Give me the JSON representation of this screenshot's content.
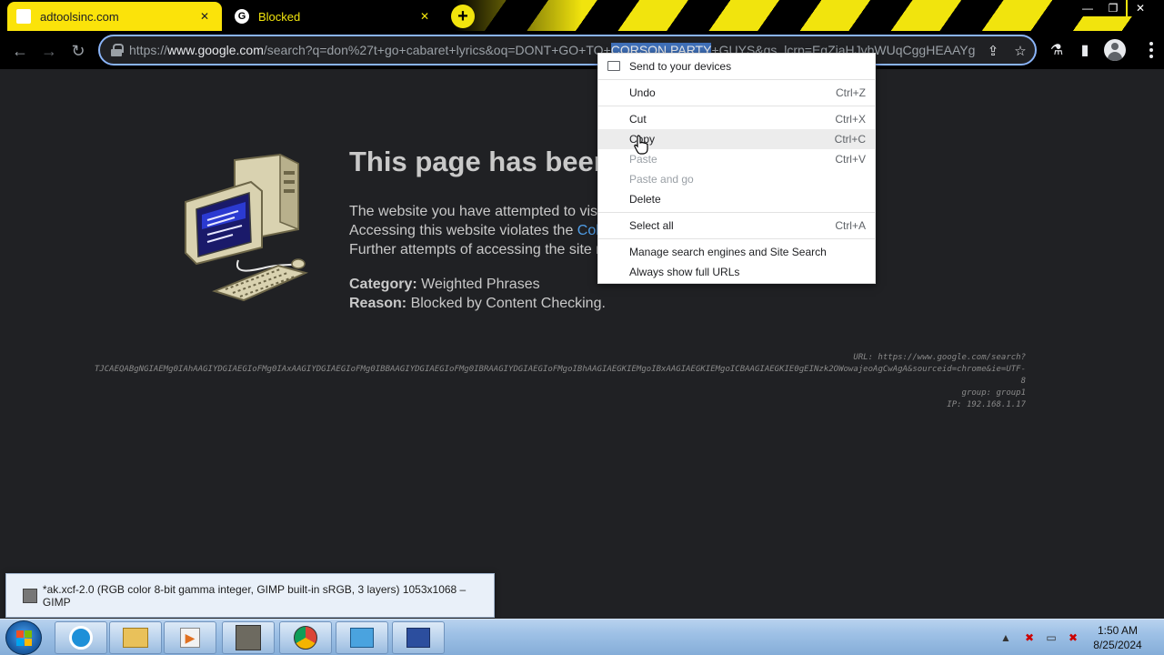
{
  "browser": {
    "tabs": [
      {
        "title": "adtoolsinc.com",
        "active": false
      },
      {
        "title": "Blocked",
        "active": true
      }
    ],
    "new_tab_icon": "plus-icon",
    "window_controls": [
      "minimize-icon",
      "restore-icon",
      "close-icon"
    ],
    "nav": [
      "back-arrow-icon",
      "forward-arrow-icon",
      "reload-icon"
    ],
    "url": {
      "scheme": "https://",
      "host": "www.google.com",
      "path_before_selection": "/search?q=don%27t+go+cabaret+lyrics&oq=DONT+GO+TO+",
      "selected": "CORSON PARTY",
      "path_after_selection": "+GUYS&gs_lcrp=EgZjaHJvbWUqCggHEAAYgAC"
    },
    "toolbar_icons": [
      "share-icon",
      "star-icon",
      "extension-icon",
      "sidepanel-icon",
      "profile-avatar-icon",
      "menu-icon"
    ]
  },
  "page": {
    "heading": "This page has been",
    "paragraph": {
      "line1": "The website you have attempted to vis",
      "line2_prefix": "Accessing this website violates the ",
      "line2_link": "Coll",
      "line3": "Further attempts of accessing the site n"
    },
    "category_label": "Category:",
    "category_value": "Weighted Phrases",
    "reason_label": "Reason:",
    "reason_value": "Blocked by Content Checking.",
    "debug": {
      "url_line": "URL: https://www.google.com/search?",
      "url_query": "TJCAEQABgNGIAEMg0IAhAAGIYDGIAEGIoFMg0IAxAAGIYDGIAEGIoFMg0IBBAAGIYDGIAEGIoFMg0IBRAAGIYDGIAEGIoFMgoIBhAAGIAEGKIEMgoIBxAAGIAEGKIEMgoICBAAGIAEGKIE0gEINzk2OWowajeoAgCwAgA&sourceid=chrome&ie=UTF-",
      "url_tail": "8",
      "group": "group: group1",
      "ip": "IP: 192.168.1.17"
    }
  },
  "context_menu": {
    "send_to_devices": "Send to your devices",
    "items": [
      {
        "label": "Undo",
        "shortcut": "Ctrl+Z"
      },
      {
        "label": "Cut",
        "shortcut": "Ctrl+X"
      },
      {
        "label": "Copy",
        "shortcut": "Ctrl+C"
      },
      {
        "label": "Paste",
        "shortcut": "Ctrl+V"
      },
      {
        "label": "Paste and go",
        "shortcut": ""
      },
      {
        "label": "Delete",
        "shortcut": ""
      },
      {
        "label": "Select all",
        "shortcut": "Ctrl+A"
      },
      {
        "label": "Manage search engines and Site Search",
        "shortcut": ""
      },
      {
        "label": "Always show full URLs",
        "shortcut": ""
      }
    ]
  },
  "taskbar": {
    "gimp_tooltip": "*ak.xcf-2.0 (RGB color 8-bit gamma integer, GIMP built-in sRGB, 3 layers) 1053x1068 – GIMP",
    "apps": [
      "start-orb-icon",
      "browser-swirl-icon",
      "file-explorer-icon",
      "media-player-icon",
      "gimp-icon",
      "chrome-icon",
      "control-panel-icon",
      "network-app-icon"
    ],
    "tray": [
      "show-hidden-icon",
      "network-error-icon",
      "power-icon",
      "volume-muted-icon"
    ],
    "time": "1:50 AM",
    "date": "8/25/2024"
  },
  "colors": {
    "tab_active_bg": "#fbe30a",
    "stripe_yellow": "#f1e40d",
    "page_bg": "#202124",
    "link": "#4f9de6",
    "selection": "#3f6fb7",
    "omnibox_focus": "#8ab4f8"
  }
}
